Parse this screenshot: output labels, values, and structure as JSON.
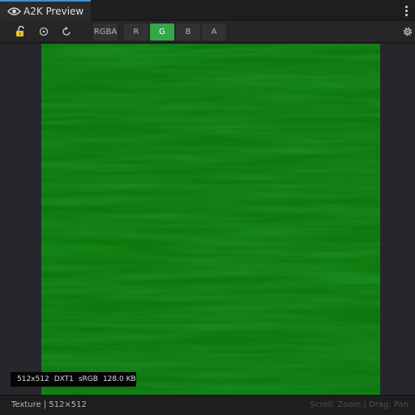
{
  "window": {
    "tab_title": "A2K Preview"
  },
  "toolbar": {
    "icons": [
      "lock-icon",
      "target-icon",
      "reset-icon",
      "settings-gear-icon"
    ],
    "channels": [
      {
        "label": "RGBA",
        "active": false
      },
      {
        "label": "R",
        "active": false
      },
      {
        "label": "G",
        "active": true
      },
      {
        "label": "B",
        "active": false
      },
      {
        "label": "A",
        "active": false
      }
    ]
  },
  "preview": {
    "texture_color": "#0d780e",
    "background_color": "#26272b",
    "info": {
      "size": "512x512",
      "format": "DXT1",
      "color_space": "sRGB",
      "memory": "128.0 KB"
    }
  },
  "status": {
    "left": "Texture | 512×512",
    "right": "Scroll: Zoom | Drag: Pan"
  },
  "colors": {
    "accent": "#3d8fd6",
    "active_channel": "#33a84a"
  }
}
